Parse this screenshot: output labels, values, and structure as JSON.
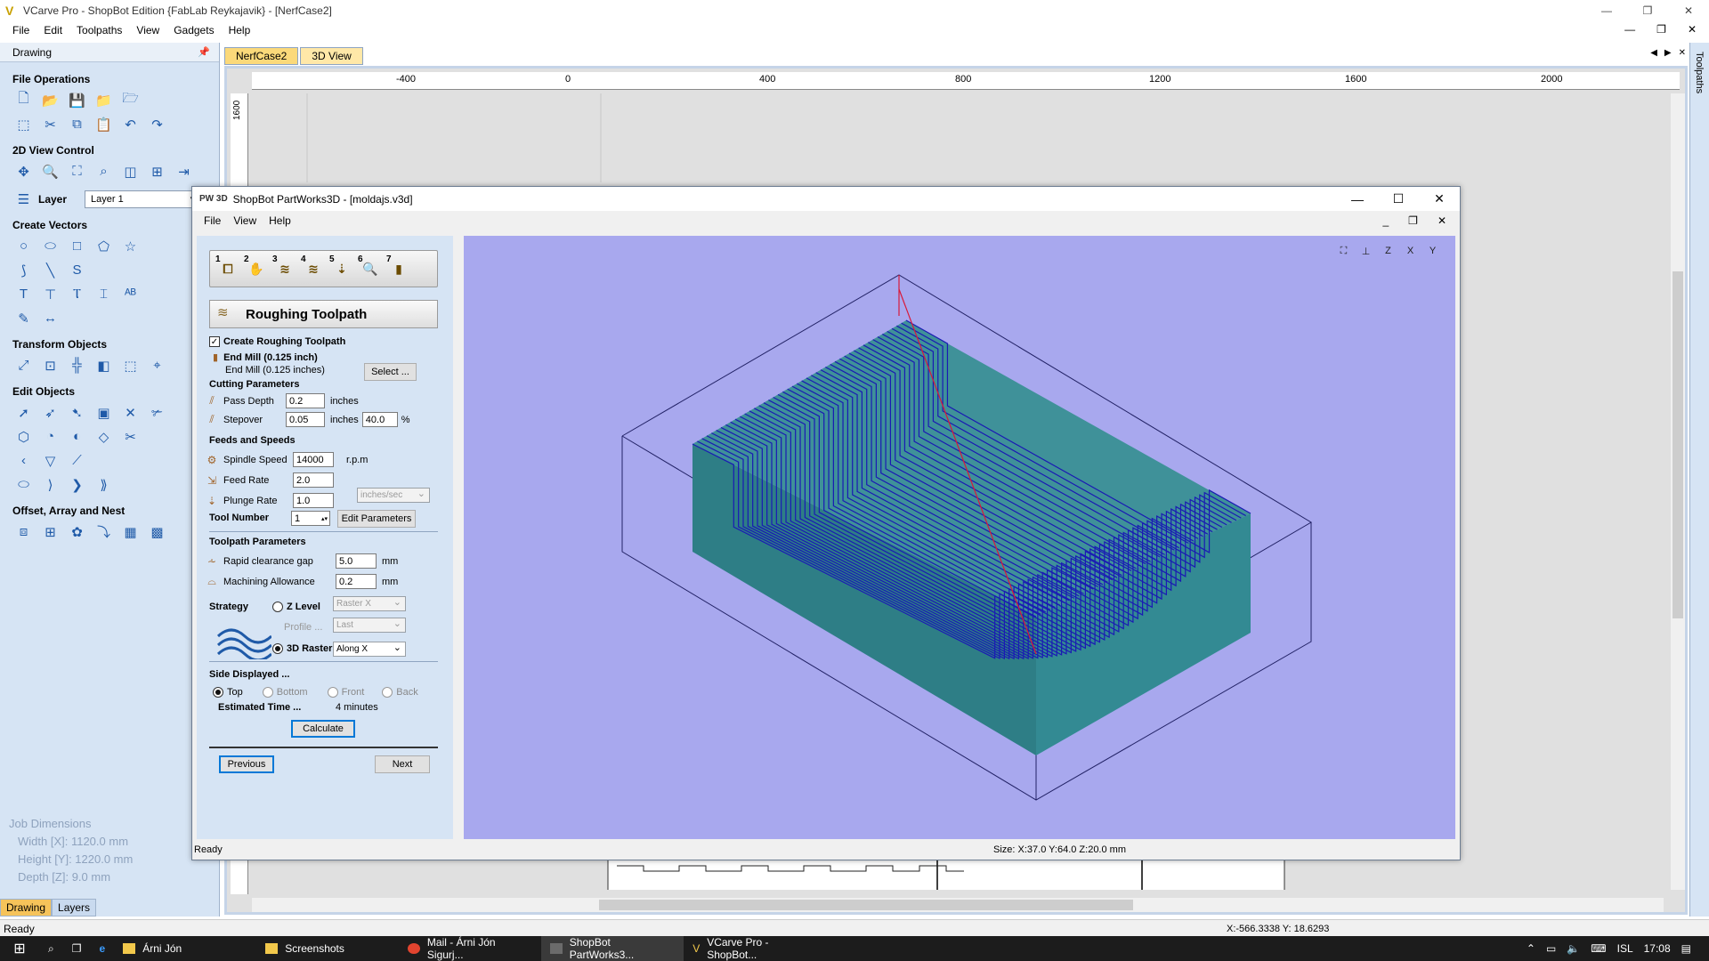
{
  "main_window": {
    "title": "VCarve Pro - ShopBot Edition {FabLab Reykajavik} - [NerfCase2]",
    "controls": {
      "minimize": "—",
      "restore": "❐",
      "close": "✕"
    },
    "menu": [
      "File",
      "Edit",
      "Toolpaths",
      "View",
      "Gadgets",
      "Help"
    ],
    "mdi_controls": {
      "minimize": "—",
      "restore": "❐",
      "close": "✕"
    }
  },
  "left_panel": {
    "header": "Drawing",
    "pin_icon": "pin-icon",
    "sections": {
      "file_operations": "File Operations",
      "view_control": "2D View Control",
      "layer_label": "Layer",
      "layer_value": "Layer 1",
      "create_vectors": "Create Vectors",
      "transform_objects": "Transform Objects",
      "edit_objects": "Edit Objects",
      "offset_array": "Offset, Array and Nest"
    },
    "job_dimensions": {
      "title": "Job Dimensions",
      "width": "Width  [X]: 1120.0 mm",
      "height": "Height [Y]: 1220.0 mm",
      "depth": "Depth  [Z]: 9.0 mm"
    },
    "tabs": [
      "Drawing",
      "Layers"
    ]
  },
  "drawing_tabs": [
    "NerfCase2",
    "3D View"
  ],
  "ruler": {
    "h_labels": [
      "-400",
      "0",
      "400",
      "800",
      "1200",
      "1600",
      "2000"
    ],
    "v_labels": [
      "1600"
    ]
  },
  "right_strip": {
    "label": "Toolpaths"
  },
  "main_status": {
    "text": "Ready",
    "coords": "X:-566.3338 Y: 18.6293"
  },
  "partworks": {
    "title": "ShopBot PartWorks3D - [moldajs.v3d]",
    "logo": "PW 3D",
    "controls": {
      "minimize": "—",
      "maximize": "☐",
      "close": "✕"
    },
    "menu": [
      "File",
      "View",
      "Help"
    ],
    "mdi_controls": {
      "minimize": "_",
      "restore": "❐",
      "close": "✕"
    },
    "steps": [
      "1",
      "2",
      "3",
      "4",
      "5",
      "6",
      "7"
    ],
    "step_title": "Roughing Toolpath",
    "create_roughing": "Create Roughing Toolpath",
    "tool_name": "End Mill (0.125 inch)",
    "tool_desc": "End Mill (0.125 inches)",
    "select_btn": "Select ...",
    "cutting_params": "Cutting Parameters",
    "pass_depth_label": "Pass Depth",
    "pass_depth_value": "0.2",
    "pass_depth_unit": "inches",
    "stepover_label": "Stepover",
    "stepover_value": "0.05",
    "stepover_unit": "inches",
    "stepover_pct": "40.0",
    "pct_sign": "%",
    "feeds_speeds": "Feeds and Speeds",
    "spindle_label": "Spindle Speed",
    "spindle_value": "14000",
    "spindle_unit": "r.p.m",
    "feed_label": "Feed Rate",
    "feed_value": "2.0",
    "plunge_label": "Plunge Rate",
    "plunge_value": "1.0",
    "rate_unit": "inches/sec",
    "tool_number_label": "Tool Number",
    "tool_number_value": "1",
    "edit_params_btn": "Edit Parameters",
    "toolpath_params": "Toolpath Parameters",
    "rapid_label": "Rapid clearance gap",
    "rapid_value": "5.0",
    "rapid_unit": "mm",
    "allowance_label": "Machining Allowance",
    "allowance_value": "0.2",
    "allowance_unit": "mm",
    "strategy_label": "Strategy",
    "zlevel_label": "Z Level",
    "zlevel_combo": "Raster X",
    "profile_label": "Profile ...",
    "profile_combo": "Last",
    "raster_label": "3D Raster",
    "raster_combo": "Along X",
    "side_displayed": "Side Displayed ...",
    "sides": [
      "Top",
      "Bottom",
      "Front",
      "Back"
    ],
    "estimated_label": "Estimated Time ...",
    "estimated_value": "4 minutes",
    "calculate_btn": "Calculate",
    "previous_btn": "Previous",
    "next_btn": "Next",
    "view_icons": [
      "zoom-extents-icon",
      "iso-view-icon",
      "z-view-icon",
      "x-view-icon",
      "y-view-icon"
    ],
    "status_text": "Ready",
    "status_size": "Size: X:37.0 Y:64.0 Z:20.0 mm",
    "colors": {
      "viewport_bg": "#a8a8ee",
      "block_top": "#3f8f98",
      "block_side": "#2f7f87",
      "toolpath": "#1a1ab4",
      "rapid": "#d81a3a",
      "box": "#222266"
    }
  },
  "taskbar": {
    "apps": [
      "Árni Jón",
      "Screenshots",
      "Mail - Árni Jón Sigurj...",
      "ShopBot PartWorks3...",
      "VCarve Pro - ShopBot..."
    ],
    "lang": "ISL",
    "time": "17:08"
  }
}
